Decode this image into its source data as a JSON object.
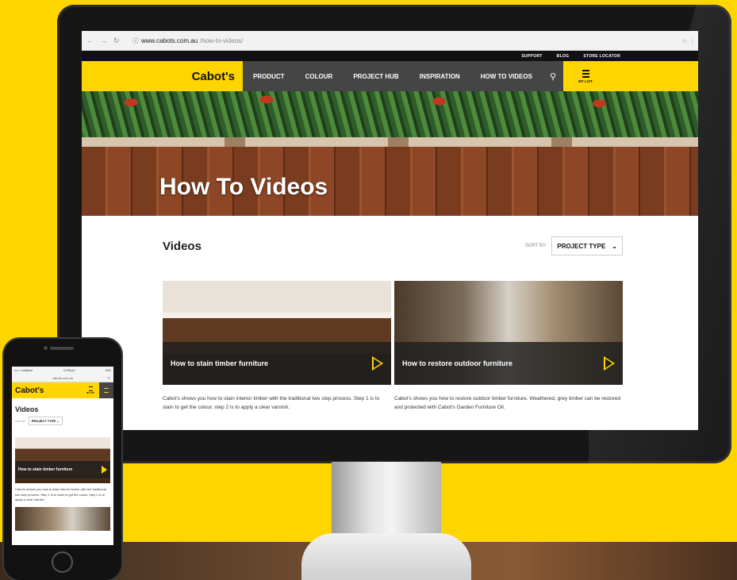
{
  "browser": {
    "url_host": "www.cabots.com.au",
    "url_path": "/how-to-videos/",
    "back_icon": "back-arrow-icon",
    "forward_icon": "forward-arrow-icon",
    "reload_icon": "reload-icon",
    "star_icon": "star-icon"
  },
  "utility_nav": [
    "SUPPORT",
    "BLOG",
    "STORE LOCATOR"
  ],
  "header": {
    "logo": "Cabot's",
    "menu": [
      "PRODUCT",
      "COLOUR",
      "PROJECT HUB",
      "INSPIRATION",
      "HOW TO VIDEOS"
    ],
    "my_list": "MY LIST"
  },
  "hero": {
    "title": "How To Videos"
  },
  "videos": {
    "heading": "Videos",
    "sort_label": "SORT BY:",
    "sort_value": "PROJECT TYPE",
    "items": [
      {
        "title": "How to stain timber furniture",
        "description": "Cabot's shows you how to stain interior timber with the traditional two step process. Step 1 is to stain to get the colour, step 2 is to apply a clear varnish."
      },
      {
        "title": "How to restore outdoor furniture",
        "description": "Cabot's shows you how to restore outdoor timber furniture. Weathered, grey timber can be restored and protected with Cabot's Garden Furniture Oil."
      }
    ]
  },
  "phone": {
    "carrier": "•••○○ vodafone",
    "time": "12:58 pm",
    "battery": "60%",
    "url": "cabots.com.au",
    "logo": "Cabot's",
    "my_list": "MY LIST",
    "heading": "Videos",
    "sort_label": "SORT BY:",
    "sort_value": "PROJECT TYPE",
    "video_title": "How to stain timber furniture",
    "video_description": "Cabot's shows you how to stain interior timber with the traditional two step process. Step 1 is to stain to get the colour, step 2 is to apply a clear varnish."
  },
  "colors": {
    "brand_yellow": "#ffd500",
    "nav_grey": "#454545"
  }
}
